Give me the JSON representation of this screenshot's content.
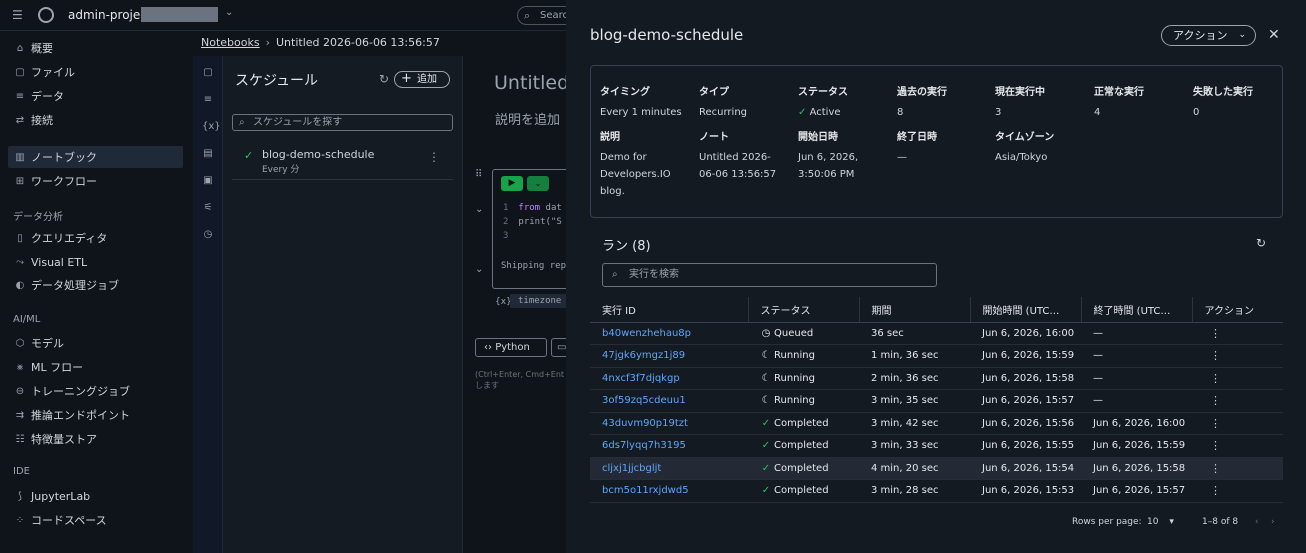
{
  "topbar": {
    "project": "admin-project-",
    "search_placeholder": "Search"
  },
  "sidebar": {
    "items": [
      {
        "label": "概要",
        "icon": "home-icon",
        "glyph": "⌂"
      },
      {
        "label": "ファイル",
        "icon": "file-icon",
        "glyph": "▢"
      },
      {
        "label": "データ",
        "icon": "database-icon",
        "glyph": "≡"
      },
      {
        "label": "接続",
        "icon": "connection-icon",
        "glyph": "⇄"
      },
      {
        "label": "ノートブック",
        "icon": "notebook-icon",
        "glyph": "▥"
      },
      {
        "label": "ワークフロー",
        "icon": "workflow-icon",
        "glyph": "⊞"
      },
      {
        "label": "クエリエディタ",
        "icon": "query-editor-icon",
        "glyph": "▯"
      },
      {
        "label": "Visual ETL",
        "icon": "etl-icon",
        "glyph": "⤳"
      },
      {
        "label": "データ処理ジョブ",
        "icon": "jobs-icon",
        "glyph": "◐"
      },
      {
        "label": "モデル",
        "icon": "model-icon",
        "glyph": "⬡"
      },
      {
        "label": "ML フロー",
        "icon": "mlflow-icon",
        "glyph": "⨳"
      },
      {
        "label": "トレーニングジョブ",
        "icon": "training-icon",
        "glyph": "⊖"
      },
      {
        "label": "推論エンドポイント",
        "icon": "endpoint-icon",
        "glyph": "⇉"
      },
      {
        "label": "特徴量ストア",
        "icon": "feature-store-icon",
        "glyph": "☷"
      },
      {
        "label": "JupyterLab",
        "icon": "jupyter-icon",
        "glyph": "⟆"
      },
      {
        "label": "コードスペース",
        "icon": "codespace-icon",
        "glyph": "⁘"
      }
    ],
    "sections": [
      "データ分析",
      "AI/ML",
      "IDE"
    ]
  },
  "breadcrumb": {
    "root": "Notebooks",
    "current": "Untitled 2026-06-06 13:56:57"
  },
  "schedules": {
    "title": "スケジュール",
    "add_label": "追加",
    "search_placeholder": "スケジュールを探す",
    "item": {
      "name": "blog-demo-schedule",
      "sub": "Every 分"
    }
  },
  "notebook": {
    "heading": "Untitled",
    "description": "説明を追加",
    "code_line1_kw": "from",
    "code_line1_rest": " dat",
    "code_line2": "print(\"S",
    "output": "Shipping rep",
    "tz_chip": "timezone",
    "tz_icon": "{x}",
    "lang_label": "Python",
    "hint": "(Ctrl+Enter, Cmd+Ent\nします"
  },
  "panel": {
    "title": "blog-demo-schedule",
    "actions_label": "アクション",
    "details": {
      "timing_label": "タイミング",
      "timing": "Every 1 minutes",
      "type_label": "タイプ",
      "type": "Recurring",
      "status_label": "ステータス",
      "status": "Active",
      "past_runs_label": "過去の実行",
      "past_runs": "8",
      "current_runs_label": "現在実行中",
      "current_runs": "3",
      "success_runs_label": "正常な実行",
      "success_runs": "4",
      "failed_runs_label": "失敗した実行",
      "failed_runs": "0",
      "desc_label": "説明",
      "desc": "Demo for Developers.IO blog.",
      "notebook_label": "ノート",
      "notebook": "Untitled 2026-06-06 13:56:57",
      "start_label": "開始日時",
      "start": "Jun 6, 2026, 3:50:06 PM",
      "end_label": "終了日時",
      "end": "—",
      "tz_label": "タイムゾーン",
      "tz": "Asia/Tokyo"
    },
    "runs_title": "ラン (8)",
    "runs_search_placeholder": "実行を検索",
    "columns": [
      "実行 ID",
      "ステータス",
      "期間",
      "開始時間 (UTC…",
      "終了時間 (UTC…",
      "アクション"
    ],
    "rows": [
      {
        "id": "b40wenzhehau8p",
        "status": "Queued",
        "status_icon": "clock-icon",
        "duration": "36 sec",
        "start": "Jun 6, 2026, 16:00",
        "end": "—"
      },
      {
        "id": "47jgk6ymgz1j89",
        "status": "Running",
        "status_icon": "spinner-icon",
        "duration": "1 min, 36 sec",
        "start": "Jun 6, 2026, 15:59",
        "end": "—"
      },
      {
        "id": "4nxcf3f7djqkgp",
        "status": "Running",
        "status_icon": "spinner-icon",
        "duration": "2 min, 36 sec",
        "start": "Jun 6, 2026, 15:58",
        "end": "—"
      },
      {
        "id": "3of59zq5cdeuu1",
        "status": "Running",
        "status_icon": "spinner-icon",
        "duration": "3 min, 35 sec",
        "start": "Jun 6, 2026, 15:57",
        "end": "—"
      },
      {
        "id": "43duvm90p19tzt",
        "status": "Completed",
        "status_icon": "check-circle-icon",
        "duration": "3 min, 42 sec",
        "start": "Jun 6, 2026, 15:56",
        "end": "Jun 6, 2026, 16:00"
      },
      {
        "id": "6ds7lyqq7h3195",
        "status": "Completed",
        "status_icon": "check-circle-icon",
        "duration": "3 min, 33 sec",
        "start": "Jun 6, 2026, 15:55",
        "end": "Jun 6, 2026, 15:59"
      },
      {
        "id": "cljxj1jjcbgljt",
        "status": "Completed",
        "status_icon": "check-circle-icon",
        "duration": "4 min, 20 sec",
        "start": "Jun 6, 2026, 15:54",
        "end": "Jun 6, 2026, 15:58"
      },
      {
        "id": "bcm5o11rxjdwd5",
        "status": "Completed",
        "status_icon": "check-circle-icon",
        "duration": "3 min, 28 sec",
        "start": "Jun 6, 2026, 15:53",
        "end": "Jun 6, 2026, 15:57"
      }
    ],
    "selected_row": 6,
    "pager": {
      "rows_per_page_label": "Rows per page:",
      "rows_per_page": "10",
      "range": "1–8 of 8"
    }
  },
  "colors": {
    "accent_link": "#60a5fa",
    "success": "#22c55e",
    "run_button": "#16a34a"
  }
}
